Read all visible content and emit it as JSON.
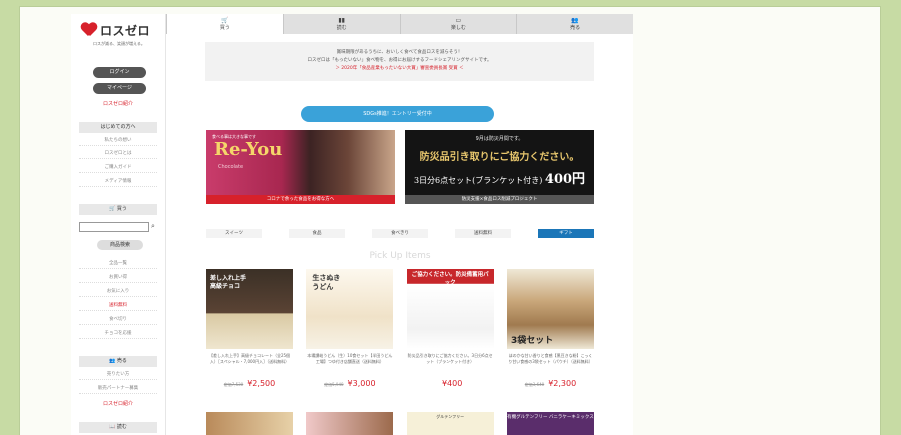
{
  "logo": {
    "text": "ロスゼロ",
    "tagline": "ロスが減る、笑顔が増える。"
  },
  "sidebar": {
    "login": "ログイン",
    "mypage": "マイページ",
    "about_link": "ロスゼロ紹介",
    "beginners_head": "はじめての方へ",
    "beginner_links": [
      "私たちの想い",
      "ロスゼロとは",
      "ご購入ガイド",
      "メディア情報"
    ],
    "buy_head": "買う",
    "search_button": "商品検索",
    "shop_links": [
      "全品一覧",
      "お買い得",
      "お気に入り",
      "送料無料",
      "食べ切り",
      "チョコを応援"
    ],
    "sell_head": "売る",
    "sell_links": [
      "売りたい方",
      "販売パートナー募集",
      "ロスゼロ紹介"
    ],
    "read_head": "読む"
  },
  "tabs": [
    {
      "icon": "cart-icon",
      "label": "買う"
    },
    {
      "icon": "book-icon",
      "label": "読む"
    },
    {
      "icon": "monitor-icon",
      "label": "楽しむ"
    },
    {
      "icon": "people-icon",
      "label": "売る"
    }
  ],
  "notice": {
    "line1": "賞味期限があるうちに、おいしく食べて食品ロスを減らそう！",
    "line2": "ロスゼロは「もったいない」食べ物を、お得にお届けするフードシェアリングサイトです。",
    "line3": "＞ 2020年「食品産業もったいない大賞」審査委員長賞 受賞 ＜"
  },
  "sdgs_button": "SDGs推進！エントリー受付中",
  "banner_a": {
    "small": "食べる事は大きな事です",
    "title": "Re-You",
    "subtitle": "Chocolate",
    "caption": "コロナで余った食品をお得な方へ"
  },
  "banner_b": {
    "line1": "9月は防災月間です。",
    "line2": "防災品引き取りにご協力ください。",
    "line3_prefix": "3日分6点セット(ブランケット付き)",
    "line3_price": "400円",
    "caption": "防災支援×食品ロス削減プロジェクト"
  },
  "categories": [
    "スイーツ",
    "食品",
    "食べきり",
    "送料無料",
    "ギフト"
  ],
  "pickup_title": "Pick Up Items",
  "products": [
    {
      "overlay": "差し入れ上手高級チョコ",
      "desc": "【差し入れ上手】高級チョコレート（全25個入）［スペシャル・7,000円入］（送料無料）",
      "old": "定価7,530",
      "price": "¥2,500"
    },
    {
      "overlay": "生さぬきうどん",
      "desc": "本場讃岐うどん（生）10食セット【半田うどん工場】つゆ付き店舗直送（送料無料）",
      "old": "定価5,940",
      "price": "¥3,000"
    },
    {
      "overlay": "ご協力ください。防災備蓄用パック",
      "desc": "防災品引き取りにご協力ください。3日分6点セット（ブランケット付き）",
      "old": "",
      "price": "¥400"
    },
    {
      "overlay": "3袋セット",
      "desc": "ほのかな甘い香りと食感【黒豆きな粉】こっくり甘い食感の3袋セット（パウチ）（送料無料）",
      "old": "定価3,640",
      "price": "¥2,300"
    }
  ],
  "product_row2_labels": [
    "",
    "",
    "グルテンフリー",
    "有機グルテンフリー バニラケーキミックス"
  ]
}
